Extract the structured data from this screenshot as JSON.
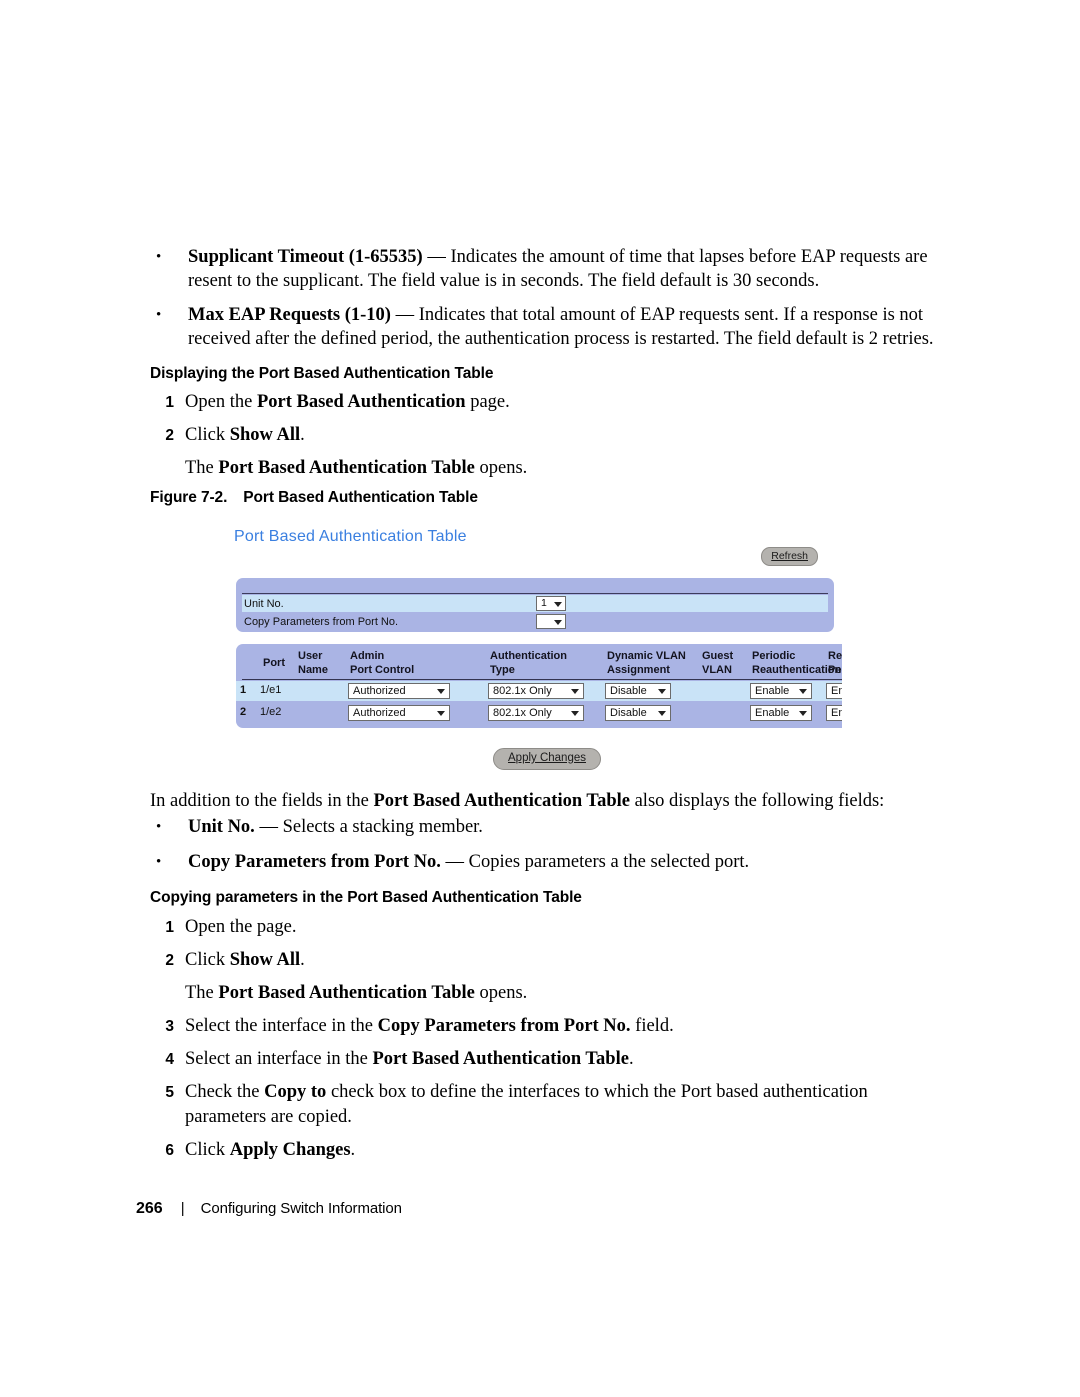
{
  "document": {
    "bullets_top": [
      {
        "marker": "•",
        "bold": "Supplicant Timeout (1-65535)",
        "rest": " — Indicates the amount of time that lapses before EAP requests are resent to the supplicant. The field value is in seconds. The field default is 30 seconds."
      },
      {
        "marker": "•",
        "bold": "Max EAP Requests (1-10)",
        "rest": " — Indicates that total amount of EAP requests sent. If a response is not received after the defined period, the authentication process is restarted. The field default is 2 retries."
      }
    ],
    "section_1": {
      "heading": "Displaying the Port Based Authentication Table",
      "steps": [
        {
          "num": "1",
          "pre": "Open the  ",
          "bold": "Port Based Authentication",
          "post": " page."
        },
        {
          "num": "2",
          "pre": "Click ",
          "bold": "Show All",
          "post": "."
        }
      ],
      "note": {
        "pre": "The ",
        "bold": "Port Based Authentication Table",
        "post": " opens."
      }
    },
    "figure": {
      "caption_label": "Figure 7-2.",
      "caption_title": "Port Based Authentication Table"
    },
    "paragraph_after_figure": {
      "pre": "In addition to the fields in the  ",
      "bold": "Port Based Authentication Table",
      "post": " also displays the following fields:"
    },
    "bullets_mid": [
      {
        "marker": "•",
        "bold": "Unit No.",
        "rest": " — Selects a stacking member."
      },
      {
        "marker": "•",
        "bold": "Copy Parameters from Port No.",
        "rest": " — Copies parameters a the selected port."
      }
    ],
    "section_2": {
      "heading": "Copying parameters in the Port Based Authentication Table",
      "steps": [
        {
          "num": "1",
          "pre": "Open the page.",
          "bold": "",
          "post": ""
        },
        {
          "num": "2",
          "pre": "Click ",
          "bold": "Show All",
          "post": "."
        }
      ],
      "note": {
        "pre": "The ",
        "bold": "Port Based Authentication Table",
        "post": " opens."
      },
      "steps_cont": [
        {
          "num": "3",
          "pre": "Select the interface in the ",
          "bold": "Copy Parameters from Port No.",
          "post": " field."
        },
        {
          "num": "4",
          "pre": "Select an interface in the ",
          "bold": "Port Based Authentication Table",
          "post": "."
        },
        {
          "num": "5",
          "pre": "Check the ",
          "bold": "Copy to",
          "post": " check box to define the interfaces to which the Port based authentication parameters are copied."
        },
        {
          "num": "6",
          "pre": "Click ",
          "bold": "Apply Changes",
          "post": "."
        }
      ]
    },
    "footer": {
      "page_number": "266",
      "separator": "|",
      "chapter": "Configuring Switch Information"
    }
  },
  "screenshot_ui": {
    "title": "Port Based Authentication Table",
    "title_color": "#3a7fe0",
    "refresh_button": "Refresh",
    "apply_button": "Apply Changes",
    "panel_bg_color": "#aab4e4",
    "row_highlight_color": "#c9e3f7",
    "fields": [
      {
        "label": "Unit No.",
        "value": "1",
        "highlighted": true
      },
      {
        "label": "Copy Parameters from Port No.",
        "value": "",
        "highlighted": false
      }
    ],
    "table": {
      "columns": [
        {
          "line1": "",
          "line2": ""
        },
        {
          "line1": "Port",
          "line2": ""
        },
        {
          "line1": "User",
          "line2": "Name"
        },
        {
          "line1": "Admin",
          "line2": "Port Control"
        },
        {
          "line1": "Authentication",
          "line2": "Type"
        },
        {
          "line1": "Dynamic VLAN",
          "line2": "Assignment"
        },
        {
          "line1": "Guest",
          "line2": "VLAN"
        },
        {
          "line1": "Periodic",
          "line2": "Reauthentication"
        },
        {
          "line1": "Rea",
          "line2": "Per"
        }
      ],
      "rows": [
        {
          "index": "1",
          "port": "1/e1",
          "user_name": "",
          "admin_port_control": "Authorized",
          "authentication_type": "802.1x Only",
          "dynamic_vlan_assignment": "Disable",
          "guest_vlan": "",
          "periodic_reauthentication": "Enable",
          "reauth_period_clipped": "En",
          "highlighted": true
        },
        {
          "index": "2",
          "port": "1/e2",
          "user_name": "",
          "admin_port_control": "Authorized",
          "authentication_type": "802.1x Only",
          "dynamic_vlan_assignment": "Disable",
          "guest_vlan": "",
          "periodic_reauthentication": "Enable",
          "reauth_period_clipped": "En",
          "highlighted": false
        }
      ]
    }
  }
}
